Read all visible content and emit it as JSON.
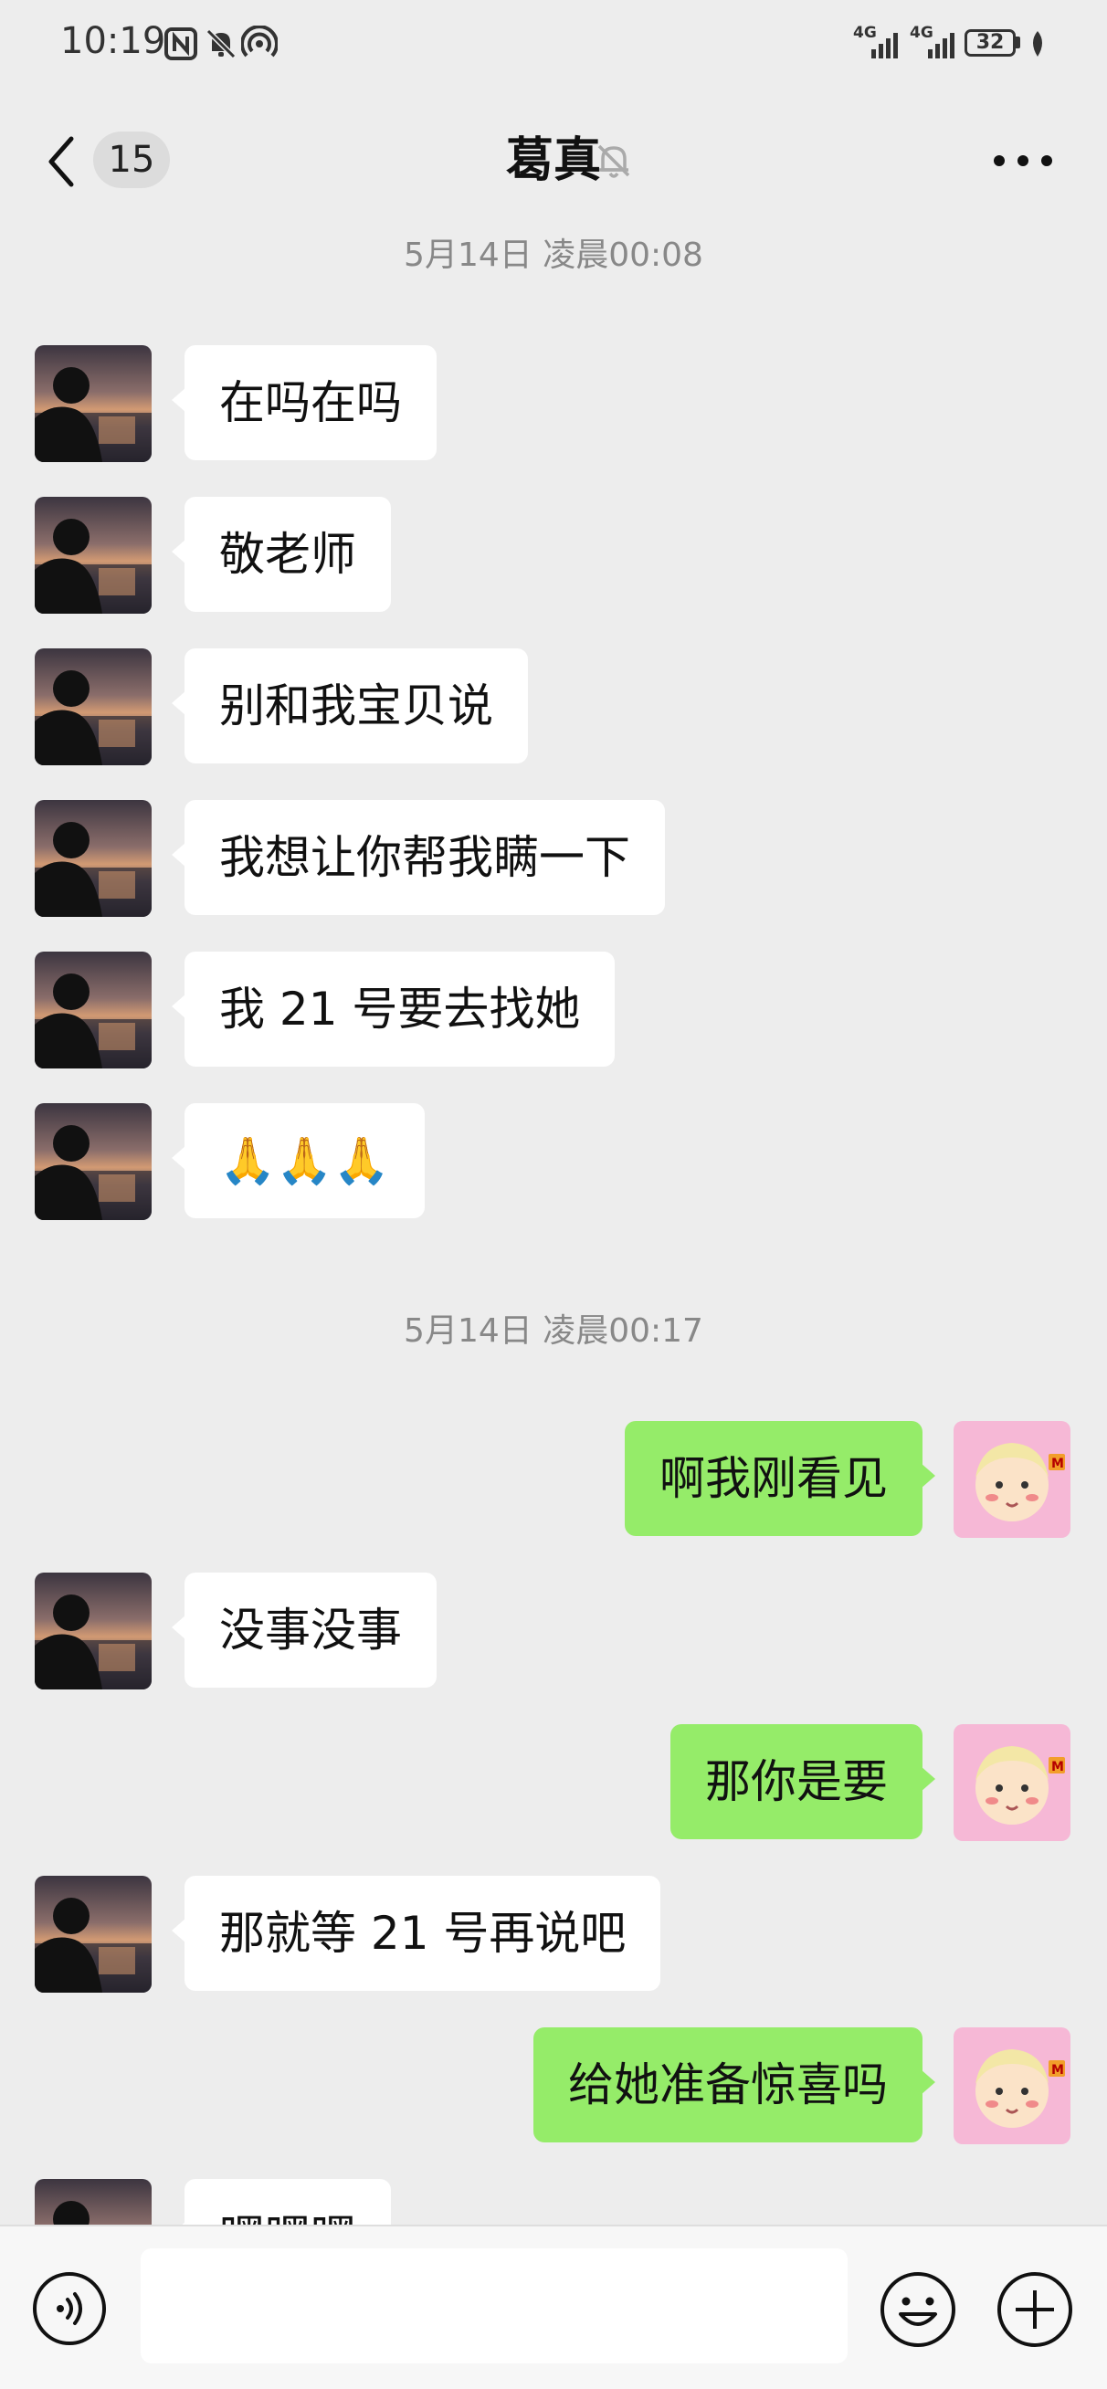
{
  "status_bar": {
    "time": "10:19",
    "signal_1": "4G",
    "signal_2": "4G",
    "battery": "32",
    "icons": [
      "nfc-icon",
      "mute-bell-icon",
      "hotspot-icon",
      "signal-icon",
      "battery-icon",
      "leaf-icon"
    ]
  },
  "nav": {
    "unread_count": "15",
    "title": "葛真",
    "icons": [
      "back-chevron-icon",
      "mute-bell-icon",
      "more-icon"
    ]
  },
  "timestamps": [
    "5月14日 凌晨00:08",
    "5月14日 凌晨00:17"
  ],
  "messages": [
    {
      "side": "left",
      "text": "在吗在吗"
    },
    {
      "side": "left",
      "text": "敬老师"
    },
    {
      "side": "left",
      "text": "别和我宝贝说"
    },
    {
      "side": "left",
      "text": "我想让你帮我瞒一下"
    },
    {
      "side": "left",
      "text": "我 21 号要去找她"
    },
    {
      "side": "left",
      "text": "🙏🙏🙏"
    },
    {
      "side": "right",
      "text": "啊我刚看见"
    },
    {
      "side": "left",
      "text": "没事没事"
    },
    {
      "side": "right",
      "text": "那你是要"
    },
    {
      "side": "left",
      "text": "那就等 21 号再说吧"
    },
    {
      "side": "right",
      "text": "给她准备惊喜吗"
    },
    {
      "side": "left",
      "text": "嘿嘿嘿"
    }
  ],
  "input_bar": {
    "placeholder": "",
    "icons": [
      "voice-icon",
      "emoji-icon",
      "plus-icon"
    ]
  },
  "colors": {
    "background": "#ededed",
    "sent_bubble": "#95ec69",
    "received_bubble": "#ffffff",
    "timestamp_text": "#888888"
  }
}
